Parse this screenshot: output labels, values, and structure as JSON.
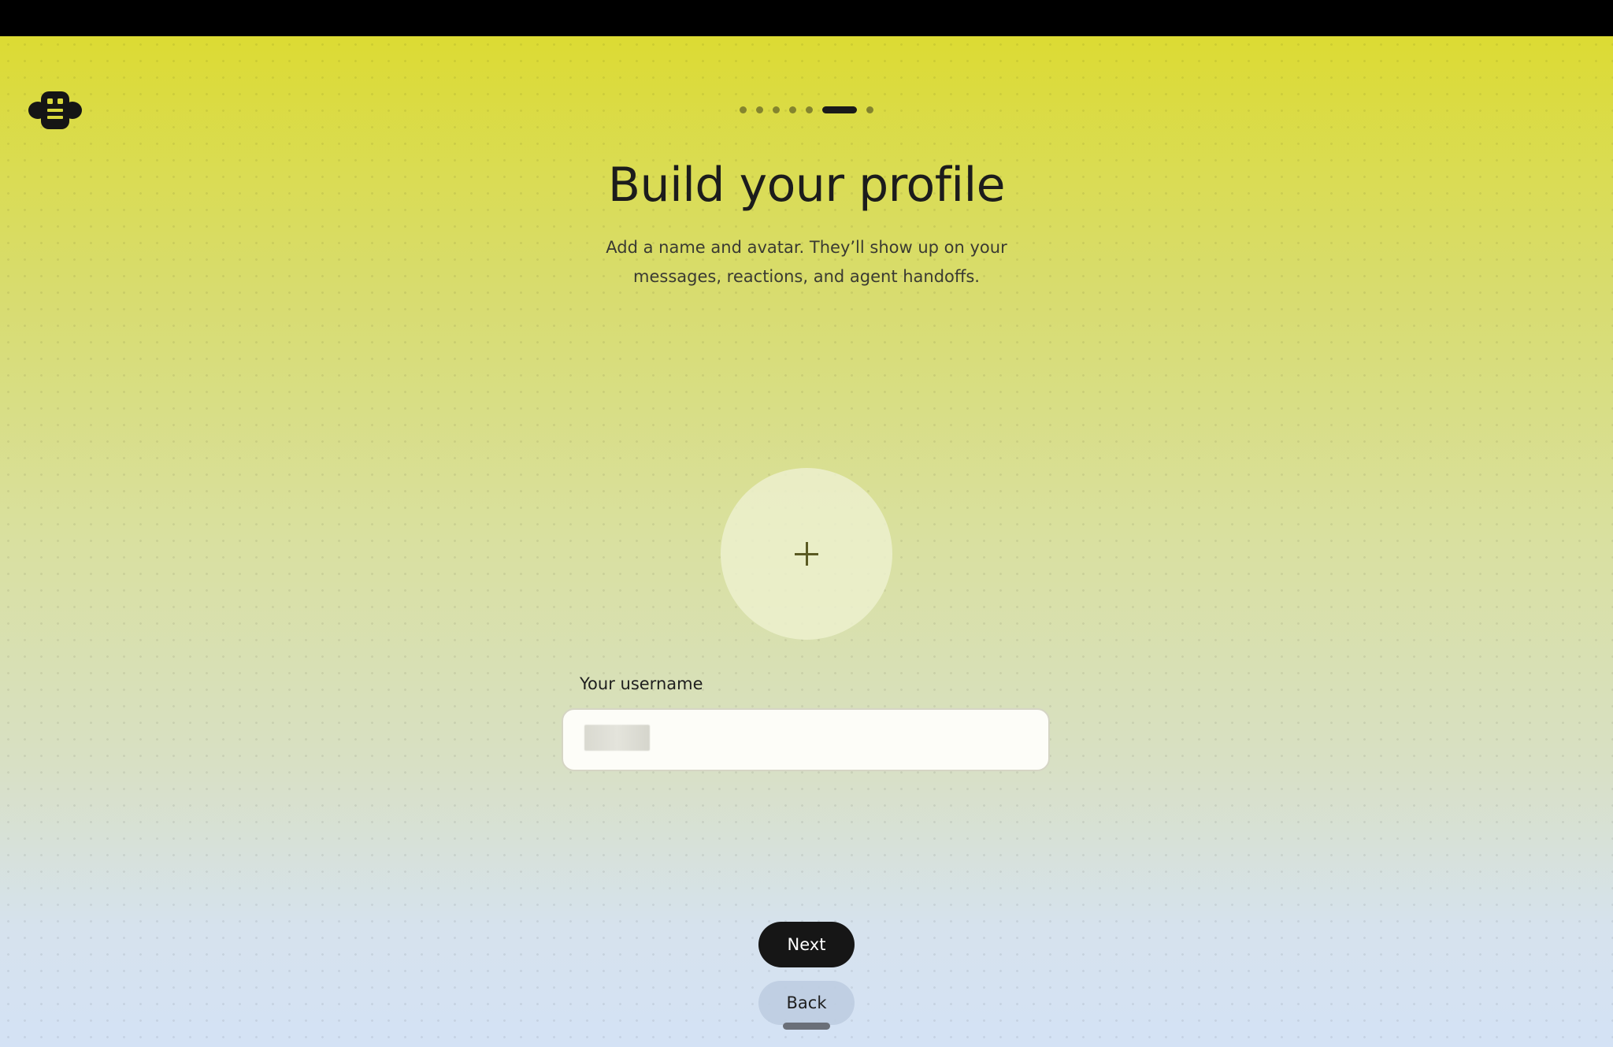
{
  "onboarding": {
    "progress": {
      "total_steps": 7,
      "current_step": 6
    },
    "title": "Build your profile",
    "subtitle": "Add a name and avatar. They’ll show up on your messages, reactions, and agent handoffs.",
    "username_field": {
      "label": "Your username",
      "value": "",
      "value_redacted": true
    },
    "avatar_icon": "plus-icon",
    "logo_icon": "robot-logo-icon",
    "buttons": {
      "next_label": "Next",
      "back_label": "Back"
    }
  },
  "colors": {
    "gradient_top": "#dcdb33",
    "gradient_bottom": "#d4e2f5",
    "primary_button": "#161616",
    "secondary_button": "#becde1",
    "text_dark": "#1c1c1c"
  }
}
